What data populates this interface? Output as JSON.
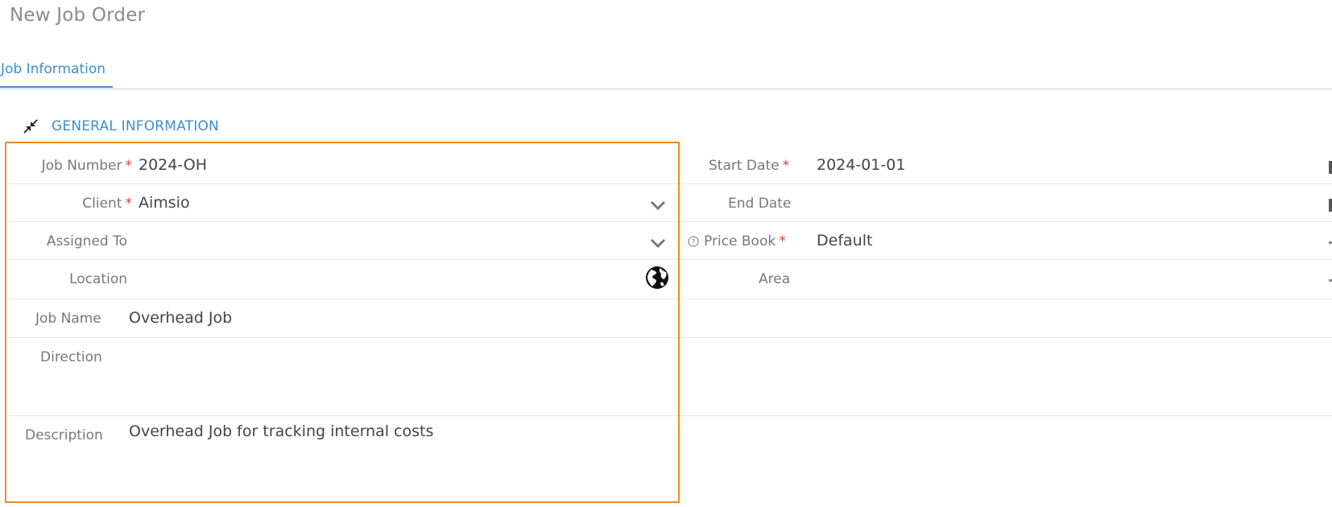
{
  "page": {
    "title": "New Job Order"
  },
  "tabs": [
    {
      "label": "Job Information",
      "active": true
    }
  ],
  "section": {
    "title": "GENERAL INFORMATION"
  },
  "left_fields": {
    "job_number": {
      "label": "Job Number",
      "required": "*",
      "value": "2024-OH"
    },
    "client": {
      "label": "Client",
      "required": "*",
      "value": "Aimsio"
    },
    "assigned_to": {
      "label": "Assigned To",
      "value": ""
    },
    "location": {
      "label": "Location",
      "value": ""
    },
    "job_name": {
      "label": "Job Name",
      "value": "Overhead Job"
    },
    "direction": {
      "label": "Direction",
      "value": ""
    },
    "description": {
      "label": "Description",
      "value": "Overhead Job for tracking internal costs"
    }
  },
  "right_fields": {
    "start_date": {
      "label": "Start Date",
      "required": "*",
      "value": "2024-01-01"
    },
    "end_date": {
      "label": "End Date",
      "value": ""
    },
    "price_book": {
      "label": "Price Book",
      "required": "*",
      "value": "Default"
    },
    "area": {
      "label": "Area",
      "value": ""
    }
  },
  "colors": {
    "accent": "#3a8fd0",
    "required": "#d9443b",
    "highlight": "#ee8a1c"
  },
  "icons": {
    "collapse": "collapse-arrows-icon",
    "dropdown": "chevron-down-icon",
    "location": "globe-icon",
    "help": "help-circle-icon"
  }
}
